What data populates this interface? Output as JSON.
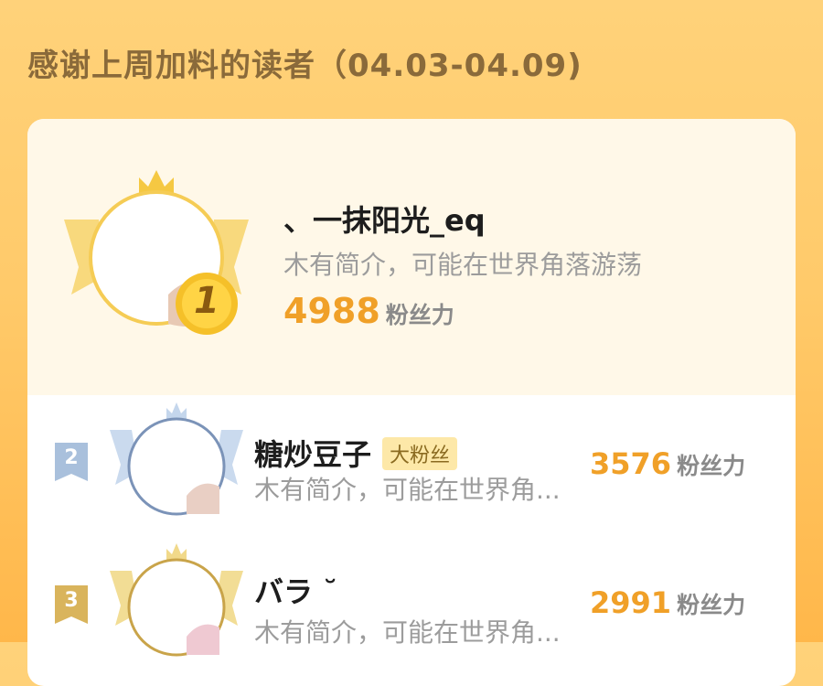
{
  "header": {
    "title": "感谢上周加料的读者（04.03-04.09)"
  },
  "colors": {
    "accent_orange": "#f0a028",
    "gold": "#f5c842",
    "silver_blue": "#a9c0dc",
    "bronze": "#d9b45c"
  },
  "leaderboard": [
    {
      "rank": "1",
      "name": "、一抹阳光_eq",
      "badge": "",
      "bio": "木有简介，可能在世界角落游荡",
      "score": "4988",
      "unit": "粉丝力"
    },
    {
      "rank": "2",
      "name": "糖炒豆子",
      "badge": "大粉丝",
      "bio": "木有简介，可能在世界角...",
      "score": "3576",
      "unit": "粉丝力"
    },
    {
      "rank": "3",
      "name": "バラ ˘",
      "badge": "",
      "bio": "木有简介，可能在世界角...",
      "score": "2991",
      "unit": "粉丝力"
    }
  ]
}
